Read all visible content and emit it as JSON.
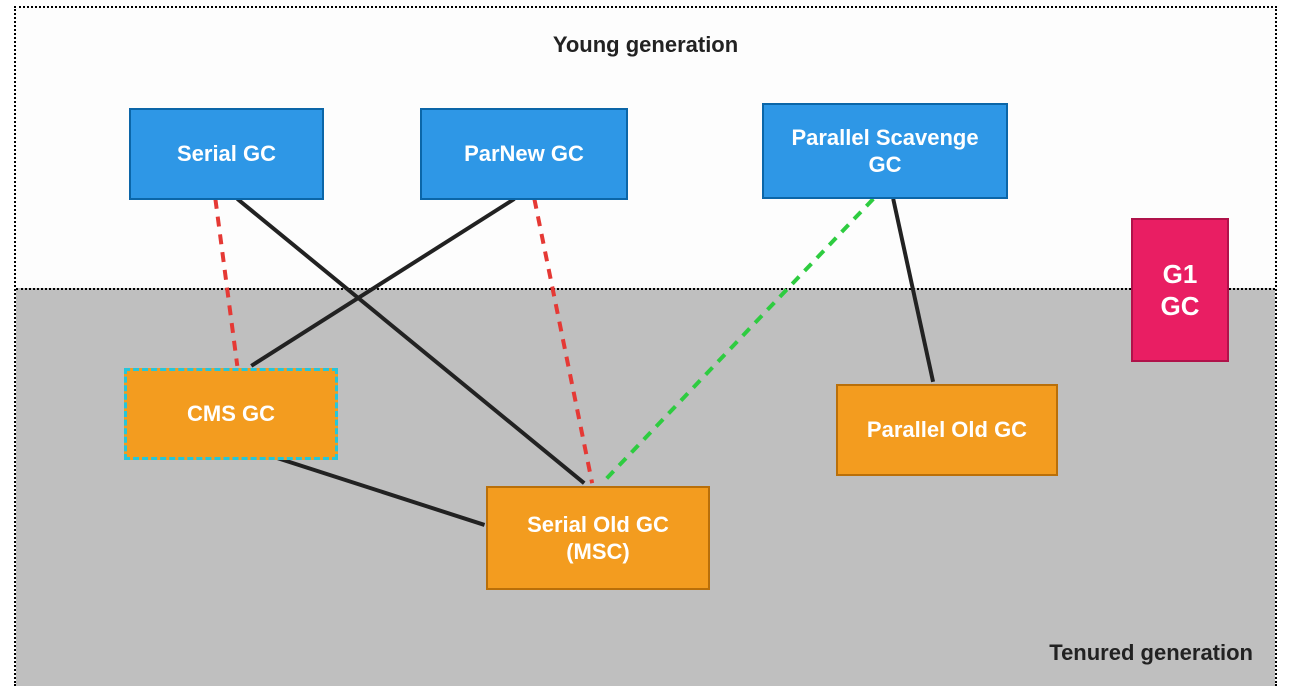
{
  "diagram": {
    "titles": {
      "young": "Young generation",
      "tenured": "Tenured generation"
    },
    "nodes": {
      "serial_gc": "Serial GC",
      "parnew_gc": "ParNew GC",
      "parallel_scavenge_gc": "Parallel Scavenge\nGC",
      "cms_gc": "CMS GC",
      "serial_old_gc": "Serial Old GC\n(MSC)",
      "parallel_old_gc": "Parallel Old GC",
      "g1_gc": "G1\nGC"
    },
    "colors": {
      "young_box": "#2e97e6",
      "old_box": "#f39c1f",
      "g1_box": "#e91e63",
      "cms_border": "#26c6da",
      "tenured_bg": "#bfbfbf",
      "solid_line": "#222222",
      "red_dashed": "#e53935",
      "green_dashed": "#2ecc40"
    },
    "edges": [
      {
        "from": "serial_gc",
        "to": "serial_old_gc",
        "style": "solid"
      },
      {
        "from": "serial_gc",
        "to": "cms_gc",
        "style": "red-dashed"
      },
      {
        "from": "parnew_gc",
        "to": "cms_gc",
        "style": "solid"
      },
      {
        "from": "parnew_gc",
        "to": "serial_old_gc",
        "style": "red-dashed"
      },
      {
        "from": "parallel_scavenge_gc",
        "to": "serial_old_gc",
        "style": "green-dashed"
      },
      {
        "from": "parallel_scavenge_gc",
        "to": "parallel_old_gc",
        "style": "solid"
      },
      {
        "from": "cms_gc",
        "to": "serial_old_gc",
        "style": "solid"
      }
    ]
  }
}
